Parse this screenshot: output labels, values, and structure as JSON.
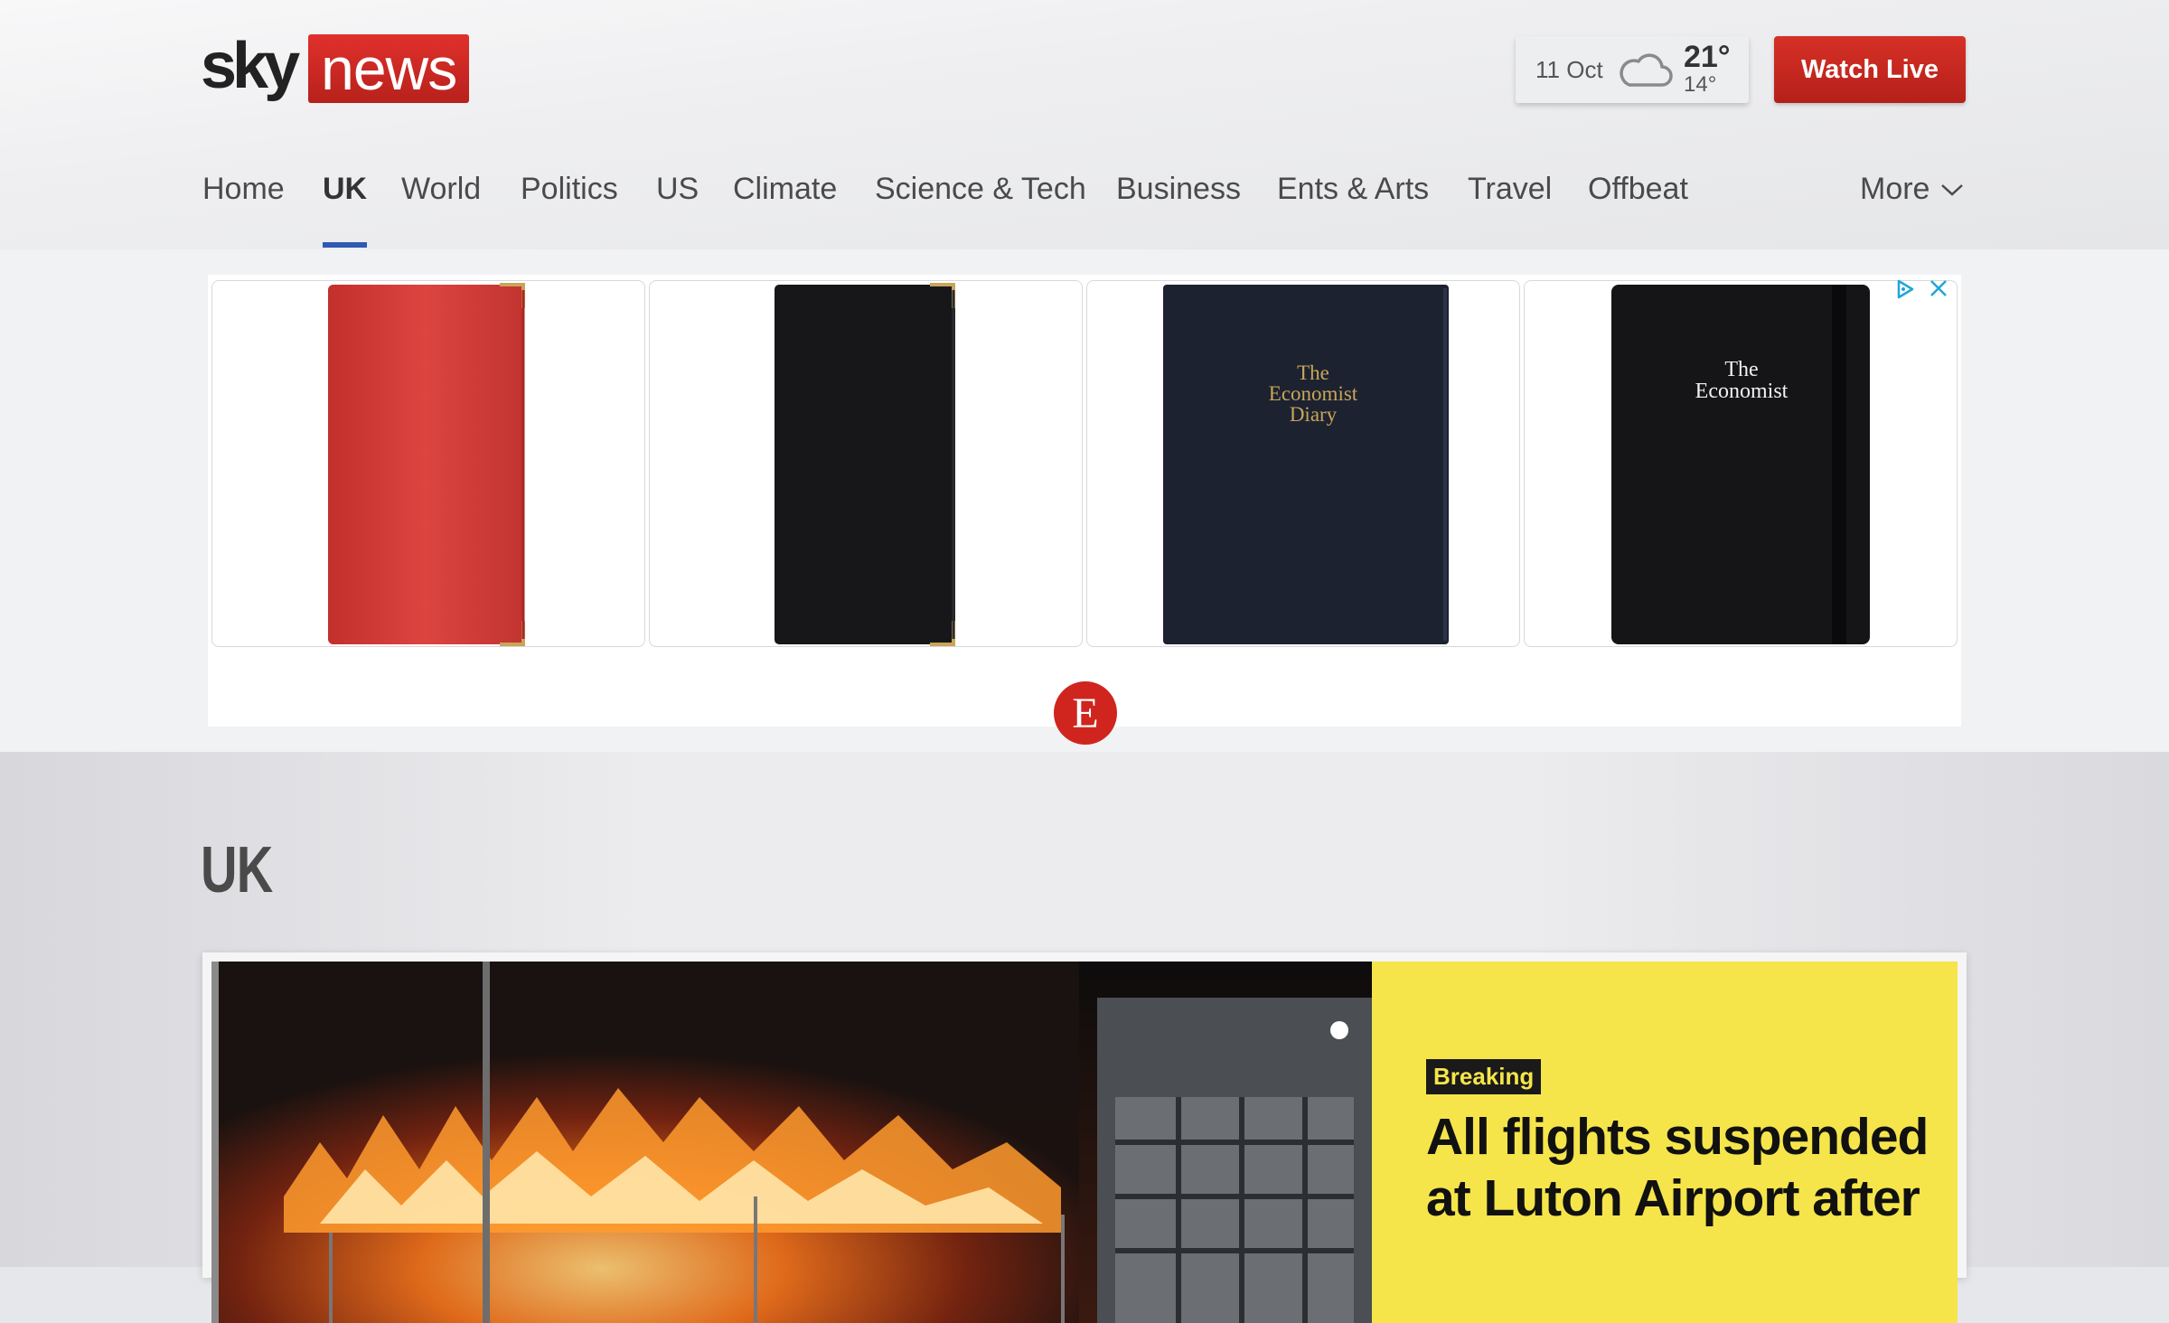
{
  "header": {
    "logo_sky": "sky",
    "logo_news": "news",
    "weather": {
      "date": "11 Oct",
      "high": "21°",
      "low": "14°",
      "icon": "cloud-icon"
    },
    "watch_live": "Watch Live"
  },
  "nav": {
    "items": [
      {
        "label": "Home",
        "active": false
      },
      {
        "label": "UK",
        "active": true
      },
      {
        "label": "World",
        "active": false
      },
      {
        "label": "Politics",
        "active": false
      },
      {
        "label": "US",
        "active": false
      },
      {
        "label": "Climate",
        "active": false
      },
      {
        "label": "Science & Tech",
        "active": false
      },
      {
        "label": "Business",
        "active": false
      },
      {
        "label": "Ents & Arts",
        "active": false
      },
      {
        "label": "Travel",
        "active": false
      },
      {
        "label": "Offbeat",
        "active": false
      }
    ],
    "more": "More"
  },
  "ad": {
    "products": [
      {
        "color": "red"
      },
      {
        "color": "black"
      },
      {
        "color": "navy",
        "title": "The\nEconomist\nDiary"
      },
      {
        "color": "black",
        "title": "The\nEconomist"
      }
    ],
    "brand_letter": "E",
    "icons": [
      "adchoices-icon",
      "close-icon"
    ]
  },
  "page": {
    "title": "UK"
  },
  "hero": {
    "badge": "Breaking",
    "headline": "All flights suspended at Luton Airport after"
  },
  "colors": {
    "brand_red": "#c8231d",
    "nav_underline": "#2f59b3",
    "breaking_yellow": "#f5e54a"
  }
}
